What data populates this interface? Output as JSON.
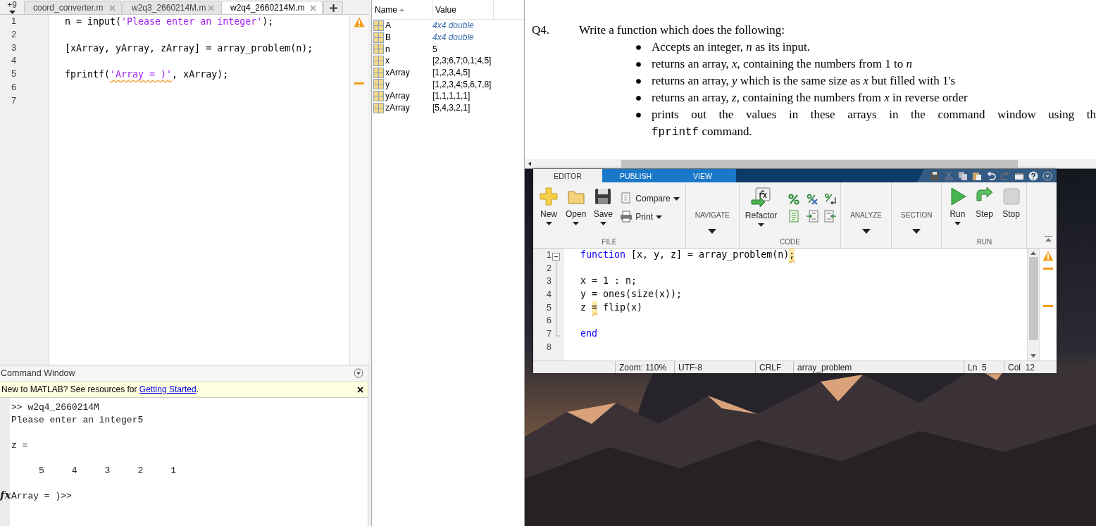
{
  "editor_tabs": {
    "overflow": "+9",
    "tabs": [
      {
        "label": "coord_converter.m",
        "selected": false
      },
      {
        "label": "w2q3_2660214M.m",
        "selected": false
      },
      {
        "label": "w2q4_2660214M.m",
        "selected": true
      }
    ]
  },
  "script_editor": {
    "lines": [
      {
        "number": "1",
        "tokens": [
          {
            "kind": "plain",
            "text": "n = input(",
            "flagged": false
          },
          {
            "kind": "string",
            "text": "'Please enter an integer'",
            "flagged": false
          },
          {
            "kind": "plain",
            "text": ");",
            "flagged": false
          }
        ]
      },
      {
        "number": "2"
      },
      {
        "number": "3",
        "tokens": [
          {
            "kind": "plain",
            "text": "[xArray, yArray, zArray] = array_problem(n);",
            "flagged": false
          }
        ]
      },
      {
        "number": "4"
      },
      {
        "number": "5",
        "tokens": [
          {
            "kind": "plain",
            "text": "fprintf(",
            "flagged": false
          },
          {
            "kind": "string",
            "text": "'Array = )'",
            "flagged": true
          },
          {
            "kind": "plain",
            "text": ", xArray);",
            "flagged": false
          }
        ]
      },
      {
        "number": "6"
      },
      {
        "number": "7"
      }
    ]
  },
  "command_window": {
    "title": "Command Window",
    "banner": {
      "text": "New to MATLAB? See resources for ",
      "link": "Getting Started",
      "after": "."
    },
    "output": [
      {
        "text": ">> w2q4_2660214M",
        "blank_before": false
      },
      {
        "text": "Please enter an integer5",
        "blank_before": false
      },
      {
        "text": "z =",
        "blank_before": true
      },
      {
        "text": "     5     4     3     2     1",
        "blank_before": true
      }
    ],
    "prompt": {
      "icon_text": "fx",
      "text": "Array = )>>",
      "blank_before": true
    }
  },
  "workspace": {
    "columns": [
      {
        "label": "Name",
        "sorted": true
      },
      {
        "label": "Value",
        "sorted": false
      }
    ],
    "variables": [
      {
        "name": "A",
        "value": "4x4 double",
        "kind": "summary"
      },
      {
        "name": "B",
        "value": "4x4 double",
        "kind": "summary"
      },
      {
        "name": "n",
        "value": "5",
        "kind": "value"
      },
      {
        "name": "x",
        "value": "[2,3;6,7;0,1;4,5]",
        "kind": "value"
      },
      {
        "name": "xArray",
        "value": "[1,2,3,4,5]",
        "kind": "value"
      },
      {
        "name": "y",
        "value": "[1,2,3,4;5,6,7,8]",
        "kind": "value"
      },
      {
        "name": "yArray",
        "value": "[1,1,1,1,1]",
        "kind": "value"
      },
      {
        "name": "zArray",
        "value": "[5,4,3,2,1]",
        "kind": "value"
      }
    ]
  },
  "document": {
    "question": "Q4.",
    "intro": "Write a function which does the following:",
    "bullets": [
      {
        "text": "Accepts an integer, *n* as its input."
      },
      {
        "text": "returns an array, *x*, containing the numbers from 1 to *n*"
      },
      {
        "text": "returns an array, *y* which is the same size as *x* but filled with 1's"
      },
      {
        "text": "returns an array, *z*, containing the numbers from *x* in reverse order"
      },
      {
        "text": "prints out the values in these arrays in the command window using th",
        "code": "fprintf",
        "after": "command."
      }
    ]
  },
  "matlab_editor": {
    "ribbon_tabs": [
      {
        "label": "EDITOR",
        "selected": true
      },
      {
        "label": "PUBLISH",
        "selected": false
      },
      {
        "label": "VIEW",
        "selected": false
      }
    ],
    "groups": [
      {
        "label": "FILE",
        "collapsed": false,
        "items": [
          {
            "kind": "large",
            "label": "New",
            "dropdown": true
          },
          {
            "kind": "large",
            "label": "Open",
            "dropdown": true
          },
          {
            "kind": "large",
            "label": "Save",
            "dropdown": true
          },
          {
            "kind": "small",
            "label": "Compare",
            "dropdown": true
          },
          {
            "kind": "small",
            "label": "Print",
            "dropdown": true
          }
        ]
      },
      {
        "label": "NAVIGATE",
        "collapsed": true
      },
      {
        "label": "CODE",
        "collapsed": false,
        "items": [
          {
            "kind": "large",
            "label": "Refactor",
            "dropdown": true
          },
          {
            "kind": "icon",
            "dropdown": false
          },
          {
            "kind": "icon",
            "dropdown": false
          },
          {
            "kind": "icon",
            "dropdown": false
          },
          {
            "kind": "icon",
            "dropdown": false
          },
          {
            "kind": "icon",
            "dropdown": false
          },
          {
            "kind": "icon",
            "dropdown": false
          }
        ]
      },
      {
        "label": "ANALYZE",
        "collapsed": true
      },
      {
        "label": "SECTION",
        "collapsed": true
      },
      {
        "label": "RUN",
        "collapsed": false,
        "items": [
          {
            "kind": "large",
            "label": "Run",
            "dropdown": true
          },
          {
            "kind": "large",
            "label": "Step",
            "dropdown": false
          },
          {
            "kind": "large",
            "label": "Stop",
            "dropdown": false
          }
        ]
      }
    ],
    "lines": [
      {
        "number": "1",
        "tokens": [
          {
            "kind": "keyword",
            "text": "function",
            "flagged": false
          },
          {
            "kind": "plain",
            "text": " [x, y, z] = array_problem(n)",
            "flagged": false
          },
          {
            "kind": "plain",
            "text": ";",
            "flagged": true
          }
        ]
      },
      {
        "number": "2"
      },
      {
        "number": "3",
        "tokens": [
          {
            "kind": "plain",
            "text": "x = 1 : n;",
            "flagged": false
          }
        ]
      },
      {
        "number": "4",
        "tokens": [
          {
            "kind": "plain",
            "text": "y = ones(size(x));",
            "flagged": false
          }
        ]
      },
      {
        "number": "5",
        "tokens": [
          {
            "kind": "plain",
            "text": "z ",
            "flagged": false
          },
          {
            "kind": "plain",
            "text": "=",
            "flagged": true
          },
          {
            "kind": "plain",
            "text": " flip(x)",
            "flagged": false
          }
        ]
      },
      {
        "number": "6"
      },
      {
        "number": "7",
        "tokens": [
          {
            "kind": "keyword",
            "text": "end",
            "flagged": false
          }
        ]
      },
      {
        "number": "8"
      }
    ],
    "status": [
      "Zoom: 110%",
      "UTF-8",
      "CRLF",
      "array_problem",
      "Ln  5",
      "Col  12"
    ]
  }
}
